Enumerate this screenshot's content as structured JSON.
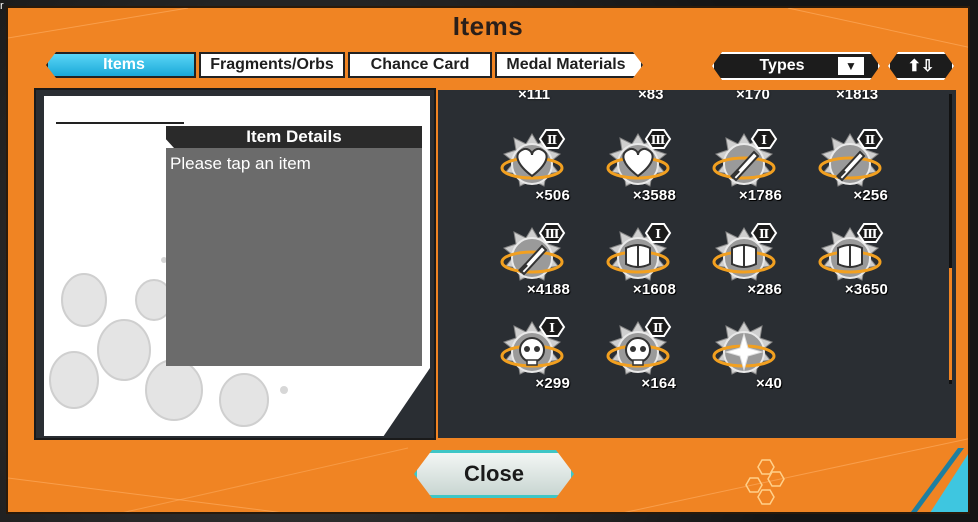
{
  "title": "Items",
  "tabs": [
    {
      "label": "Items",
      "active": true
    },
    {
      "label": "Fragments/Orbs",
      "active": false
    },
    {
      "label": "Chance Card",
      "active": false
    },
    {
      "label": "Medal Materials",
      "active": false
    }
  ],
  "filter": {
    "label": "Types",
    "arrow": "▼"
  },
  "sort": {
    "label": "⬆⇩"
  },
  "details": {
    "header": "Item Details",
    "placeholder": "Please tap an item"
  },
  "top_row_counts": [
    "×111",
    "×83",
    "×170",
    "×1813"
  ],
  "items": [
    {
      "icon": "heart-medal-icon",
      "rank": "Ⅱ",
      "count": "×506"
    },
    {
      "icon": "heart-medal-icon",
      "rank": "Ⅲ",
      "count": "×3588"
    },
    {
      "icon": "sword-medal-icon",
      "rank": "Ⅰ",
      "count": "×1786"
    },
    {
      "icon": "sword-medal-icon",
      "rank": "Ⅱ",
      "count": "×256"
    },
    {
      "icon": "sword-medal-icon",
      "rank": "Ⅲ",
      "count": "×4188"
    },
    {
      "icon": "armor-medal-icon",
      "rank": "Ⅰ",
      "count": "×1608"
    },
    {
      "icon": "armor-medal-icon",
      "rank": "Ⅱ",
      "count": "×286"
    },
    {
      "icon": "armor-medal-icon",
      "rank": "Ⅲ",
      "count": "×3650"
    },
    {
      "icon": "skull-medal-icon",
      "rank": "Ⅰ",
      "count": "×299"
    },
    {
      "icon": "skull-medal-icon",
      "rank": "Ⅱ",
      "count": "×164"
    },
    {
      "icon": "sparkle-medal-icon",
      "rank": "",
      "count": "×40"
    }
  ],
  "close_label": "Close",
  "corner_char": "r",
  "colors": {
    "accent": "#f08423",
    "tab_active": "#1aa8d8",
    "close_border": "#3ec6c6"
  }
}
